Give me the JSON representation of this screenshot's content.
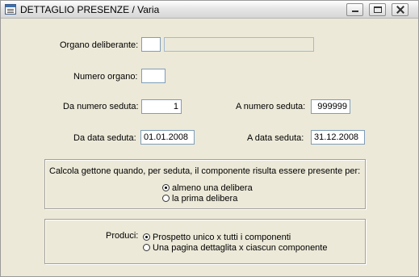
{
  "window": {
    "title": "DETTAGLIO PRESENZE / Varia",
    "icon": "form-window-icon",
    "controls": {
      "minimize": "minimize-icon",
      "maximize": "maximize-icon",
      "close": "close-icon"
    }
  },
  "form": {
    "organo_deliberante": {
      "label": "Organo deliberante:",
      "code": "",
      "description": ""
    },
    "numero_organo": {
      "label": "Numero organo:",
      "value": ""
    },
    "da_numero_seduta": {
      "label": "Da numero seduta:",
      "value": "1"
    },
    "a_numero_seduta": {
      "label": "A  numero seduta:",
      "value": "999999"
    },
    "da_data_seduta": {
      "label": "Da data seduta:",
      "value": "01.01.2008"
    },
    "a_data_seduta": {
      "label": "A  data seduta:",
      "value": "31.12.2008"
    }
  },
  "gettone": {
    "caption": "Calcola gettone quando, per seduta, il componente risulta essere presente per:",
    "options": [
      {
        "label": "almeno una delibera",
        "selected": true
      },
      {
        "label": "la prima delibera",
        "selected": false
      }
    ]
  },
  "produci": {
    "caption": "Produci:",
    "options": [
      {
        "label": "Prospetto unico x tutti i componenti",
        "selected": true
      },
      {
        "label": "Una pagina dettaglita x ciascun componente",
        "selected": false
      }
    ]
  }
}
